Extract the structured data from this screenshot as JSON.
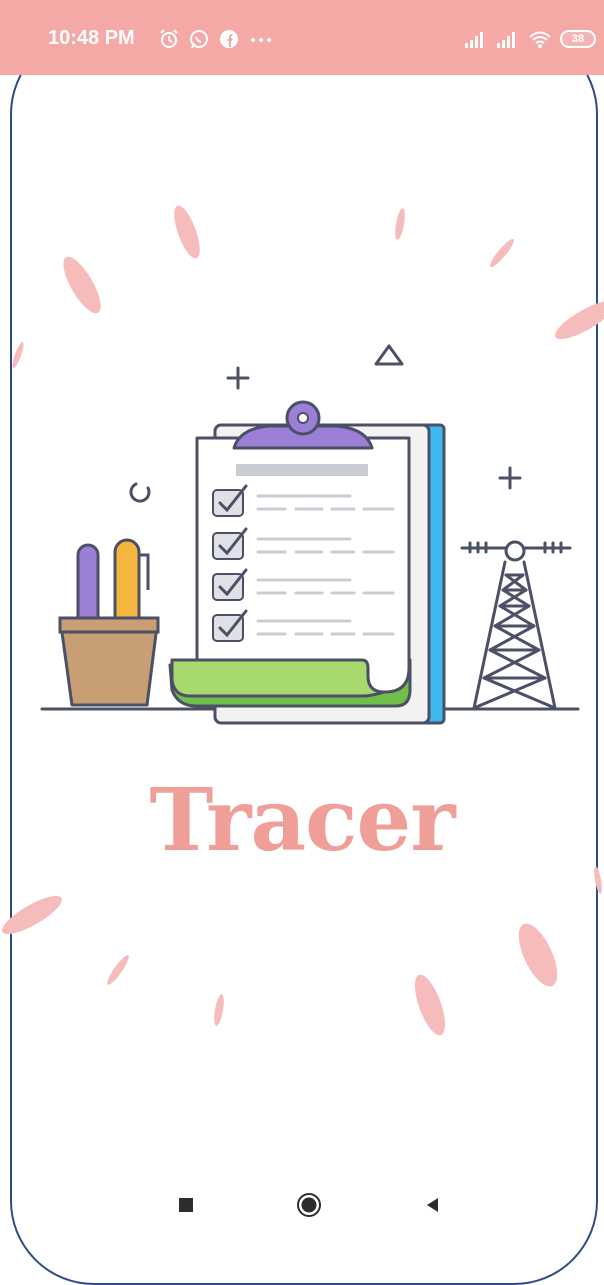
{
  "status_bar": {
    "time": "10:48 PM",
    "left_icons": [
      "alarm-icon",
      "whatsapp-icon",
      "facebook-icon",
      "more-dots-icon"
    ],
    "right_icons": [
      "signal-icon",
      "signal-icon",
      "wifi-icon"
    ],
    "battery_level": "38"
  },
  "app": {
    "title": "Tracer"
  },
  "nav_bar": {
    "buttons": [
      "recents-button",
      "home-button",
      "back-button"
    ]
  },
  "colors": {
    "status_bar": "#f4a9a7",
    "title": "#ef9f98",
    "frame": "#2e4a8a",
    "clipboard_clip": "#9b7fd6",
    "sheet_green": "#a8d96e",
    "binder_blue": "#3db8f0"
  }
}
